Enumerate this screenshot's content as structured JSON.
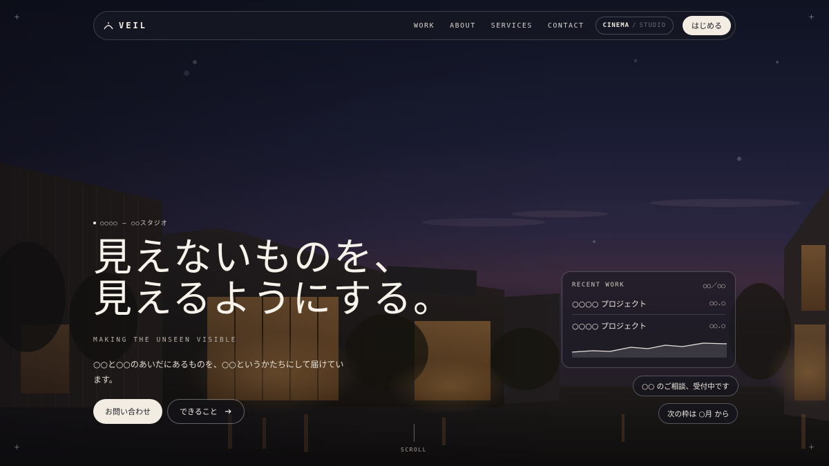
{
  "nav": {
    "brand": "VEIL",
    "links": [
      "WORK",
      "ABOUT",
      "SERVICES",
      "CONTACT"
    ],
    "mode_active": "CINEMA",
    "mode_separator": "/",
    "mode_inactive": "STUDIO",
    "start_label": "はじめる"
  },
  "hero": {
    "eyebrow": "○○○○ — ○○スタジオ",
    "headline_line1": "見えないものを、",
    "headline_line2": "見えるようにする。",
    "tagline": "MAKING THE UNSEEN VISIBLE",
    "description": "○○と○○のあいだにあるものを、○○というかたちにして届けています。",
    "primary_cta": "お問い合わせ",
    "secondary_cta": "できること"
  },
  "recent_work": {
    "title": "RECENT WORK",
    "count": "○○／○○",
    "items": [
      {
        "name": "○○○○ プロジェクト",
        "meta": "○○.○"
      },
      {
        "name": "○○○○ プロジェクト",
        "meta": "○○.○"
      }
    ]
  },
  "status": {
    "availability": "○○ のご相談、受付中です",
    "next_slot": "次の枠は ○月 から"
  },
  "scroll_label": "SCROLL",
  "colors": {
    "accent_light": "#f3ece3",
    "background": "#141622"
  }
}
